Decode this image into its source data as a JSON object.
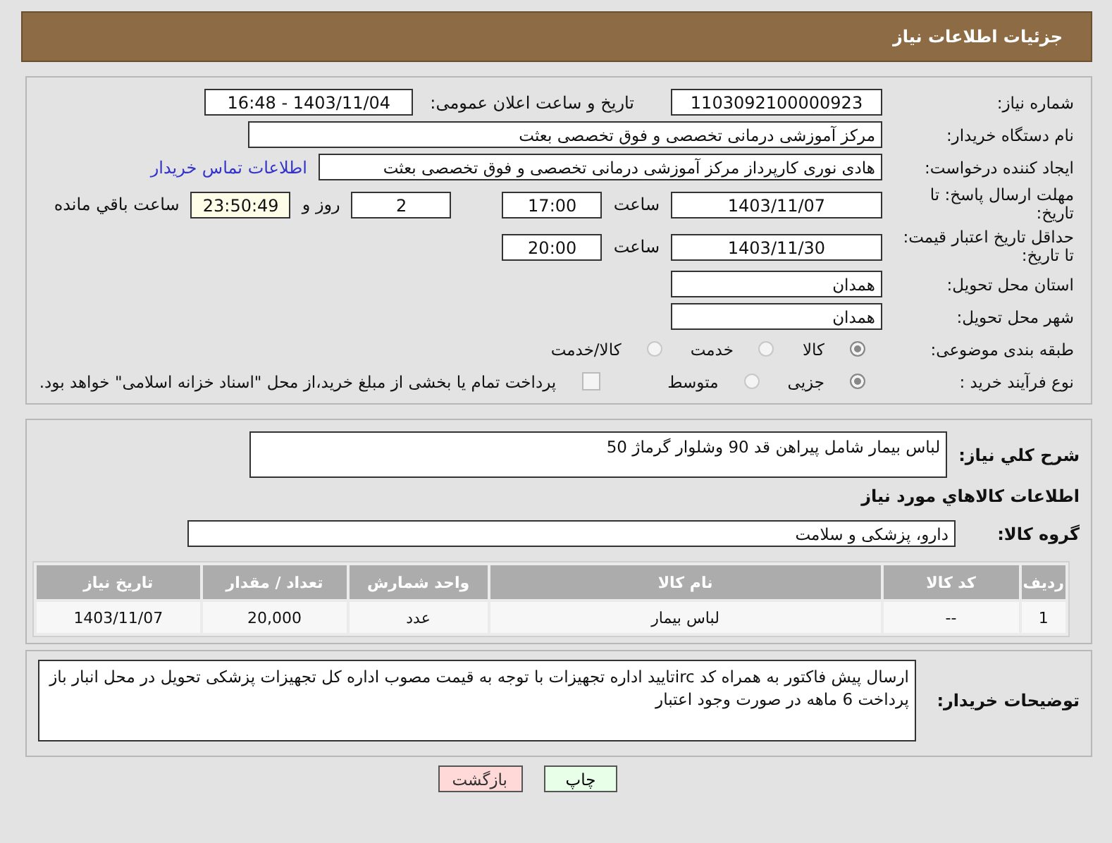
{
  "header": {
    "title": "جزئیات اطلاعات نیاز"
  },
  "need_number": {
    "label": "شماره نیاز:",
    "value": "1103092100000923"
  },
  "announce": {
    "label": "تاریخ و ساعت اعلان عمومی:",
    "value": "1403/11/04 - 16:48"
  },
  "buyer": {
    "label": "نام دستگاه خریدار:",
    "value": "مرکز آموزشی درمانی تخصصی و فوق تخصصی بعثت"
  },
  "creator": {
    "label": "ایجاد کننده درخواست:",
    "value": "هادی نوری کارپرداز مرکز آموزشی درمانی تخصصی و فوق تخصصی بعثت",
    "link": "اطلاعات تماس خریدار"
  },
  "deadline": {
    "label": "مهلت ارسال پاسخ: تا تاریخ:",
    "date": "1403/11/07",
    "time_label": "ساعت",
    "time": "17:00",
    "days": "2",
    "days_label": "روز و",
    "remaining": "23:50:49",
    "remaining_label": "ساعت باقي مانده"
  },
  "validity": {
    "label": "حداقل تاریخ اعتبار قیمت: تا تاریخ:",
    "date": "1403/11/30",
    "time_label": "ساعت",
    "time": "20:00"
  },
  "province": {
    "label": "استان محل تحویل:",
    "value": "همدان"
  },
  "city": {
    "label": "شهر محل تحویل:",
    "value": "همدان"
  },
  "category": {
    "label": "طبقه بندی موضوعی:",
    "options": [
      {
        "label": "کالا",
        "selected": true
      },
      {
        "label": "خدمت",
        "selected": false
      },
      {
        "label": "کالا/خدمت",
        "selected": false
      }
    ]
  },
  "process": {
    "label": "نوع فرآیند خرید :",
    "options": [
      {
        "label": "جزیی",
        "selected": true
      },
      {
        "label": "متوسط",
        "selected": false
      }
    ],
    "treasury": {
      "checked": false,
      "label": "پرداخت تمام یا بخشی از مبلغ خرید،از محل \"اسناد خزانه اسلامی\" خواهد بود."
    }
  },
  "description": {
    "label": "شرح کلي نياز:",
    "value": "لباس بیمار شامل پیراهن قد 90 وشلوار گرماژ 50"
  },
  "goods_heading": "اطلاعات کالاهاي مورد نياز",
  "goods_group": {
    "label": "گروه کالا:",
    "value": "دارو، پزشکی و سلامت"
  },
  "table": {
    "columns": [
      "ردیف",
      "کد کالا",
      "نام کالا",
      "واحد شمارش",
      "تعداد / مقدار",
      "تاریخ نیاز"
    ],
    "rows": [
      [
        "1",
        "--",
        "لباس بیمار",
        "عدد",
        "20,000",
        "1403/11/07"
      ]
    ]
  },
  "buyer_notes": {
    "label": "توضیحات خریدار:",
    "value": "ارسال پیش فاکتور به همراه کد ircتایید اداره تجهیزات  با توجه به قیمت مصوب اداره کل تجهیزات پزشکی تحویل در محل انبار باز پرداخت 6 ماهه در صورت وجود اعتبار"
  },
  "buttons": [
    {
      "label": "چاپ",
      "kind": "print"
    },
    {
      "label": "بازگشت",
      "kind": "back"
    }
  ]
}
